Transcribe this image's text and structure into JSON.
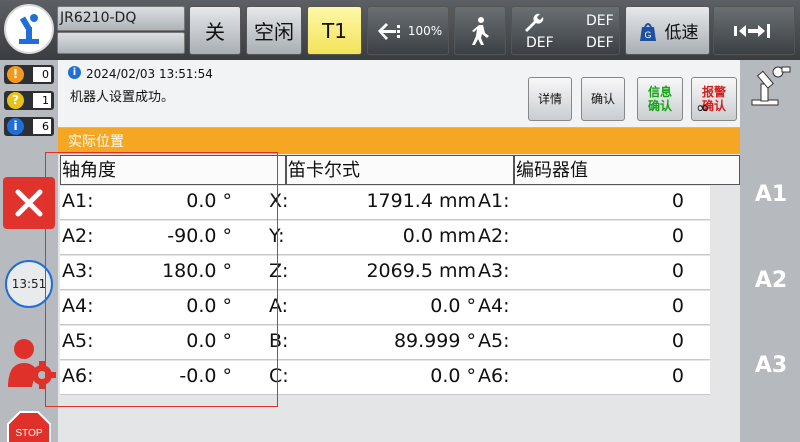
{
  "header": {
    "robot_name": "JR6210-DQ",
    "mode_label": "关",
    "state_label": "空闲",
    "tool_label": "T1",
    "speed_percent": "100%",
    "def_top": "DEF",
    "def_bottom_left": "DEF",
    "def_bottom_right": "DEF",
    "speed_mode": "低速",
    "speed_badge": "G"
  },
  "counters": [
    {
      "icon": "!",
      "count": "0",
      "color": "#f39a1e"
    },
    {
      "icon": "?",
      "count": "1",
      "color": "#e8c21c"
    },
    {
      "icon": "i",
      "count": "6",
      "color": "#1f6fd6"
    }
  ],
  "sidebar": {
    "clock": "13:51"
  },
  "message": {
    "timestamp": "2024/02/03 13:51:54",
    "text": "机器人设置成功。",
    "btn_details": "详情",
    "btn_confirm": "确认",
    "btn_info_confirm_1": "信息",
    "btn_info_confirm_2": "确认",
    "btn_alarm_confirm_1": "报警",
    "btn_alarm_confirm_2": "确认",
    "inf_symbol": "∞"
  },
  "panel": {
    "title": "实际位置",
    "headers": [
      "轴角度",
      "笛卡尔式",
      "编码器值"
    ],
    "rows": [
      {
        "axis": "A1:",
        "axis_val": "0.0 °",
        "cart": "X:",
        "cart_val": "1791.4 mm",
        "enc": "A1:",
        "enc_val": "0"
      },
      {
        "axis": "A2:",
        "axis_val": "-90.0 °",
        "cart": "Y:",
        "cart_val": "0.0 mm",
        "enc": "A2:",
        "enc_val": "0"
      },
      {
        "axis": "A3:",
        "axis_val": "180.0 °",
        "cart": "Z:",
        "cart_val": "2069.5 mm",
        "enc": "A3:",
        "enc_val": "0"
      },
      {
        "axis": "A4:",
        "axis_val": "0.0 °",
        "cart": "A:",
        "cart_val": "0.0 °",
        "enc": "A4:",
        "enc_val": "0"
      },
      {
        "axis": "A5:",
        "axis_val": "0.0 °",
        "cart": "B:",
        "cart_val": "89.999 °",
        "enc": "A5:",
        "enc_val": "0"
      },
      {
        "axis": "A6:",
        "axis_val": "-0.0 °",
        "cart": "C:",
        "cart_val": "0.0 °",
        "enc": "A6:",
        "enc_val": "0"
      }
    ]
  },
  "rightbar": {
    "axes": [
      "A1",
      "A2",
      "A3"
    ]
  },
  "stop_label": "STOP"
}
